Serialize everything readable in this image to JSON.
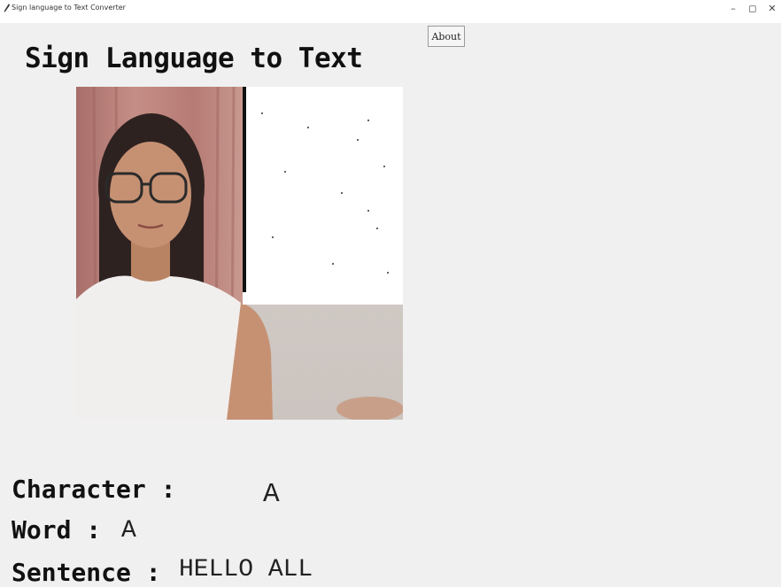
{
  "window": {
    "title": "Sign language to Text Converter",
    "controls": {
      "minimize": "–",
      "maximize": "◻",
      "close": "✕"
    }
  },
  "header": {
    "about_label": "About",
    "title": "Sign Language to Text"
  },
  "output": {
    "character_label": "Character :",
    "character_value": "A",
    "word_label": "Word :",
    "word_value": "A",
    "sentence_label": "Sentence :",
    "sentence_value": "HELLO ALL"
  }
}
